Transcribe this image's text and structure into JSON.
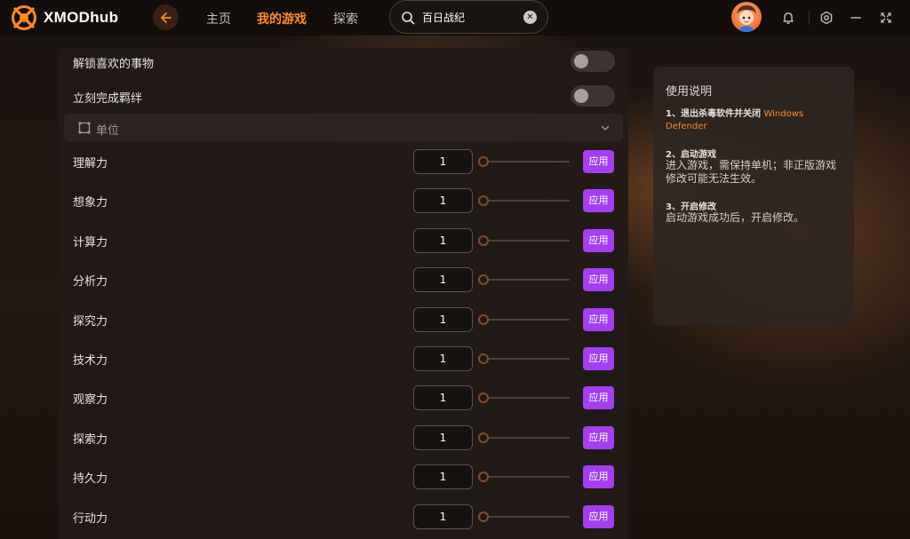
{
  "app": {
    "name": "XMODhub",
    "brand_color": "#ff8a2a",
    "accent_color": "#a43ef0"
  },
  "nav": {
    "items": [
      {
        "label": "主页",
        "active": false
      },
      {
        "label": "我的游戏",
        "active": true
      },
      {
        "label": "探索",
        "active": false
      }
    ]
  },
  "search": {
    "value": "百日战纪"
  },
  "toggles": [
    {
      "label": "解锁喜欢的事物",
      "on": false
    },
    {
      "label": "立刻完成羁绊",
      "on": false
    }
  ],
  "section": {
    "title": "单位",
    "icon": "unit-icon"
  },
  "stats": [
    {
      "label": "理解力",
      "value": "1",
      "button": "应用"
    },
    {
      "label": "想象力",
      "value": "1",
      "button": "应用"
    },
    {
      "label": "计算力",
      "value": "1",
      "button": "应用"
    },
    {
      "label": "分析力",
      "value": "1",
      "button": "应用"
    },
    {
      "label": "探究力",
      "value": "1",
      "button": "应用"
    },
    {
      "label": "技术力",
      "value": "1",
      "button": "应用"
    },
    {
      "label": "观察力",
      "value": "1",
      "button": "应用"
    },
    {
      "label": "探索力",
      "value": "1",
      "button": "应用"
    },
    {
      "label": "持久力",
      "value": "1",
      "button": "应用"
    },
    {
      "label": "行动力",
      "value": "1",
      "button": "应用"
    }
  ],
  "instructions": {
    "title": "使用说明",
    "step1_title": "1、退出杀毒软件并关闭",
    "step1_highlight": "Windows Defender",
    "step2_title": "2、启动游戏",
    "step2_body": "进入游戏，需保持单机；非正版游戏修改可能无法生效。",
    "step3_title": "3、开启修改",
    "step3_body": "启动游戏成功后，开启修改。"
  }
}
